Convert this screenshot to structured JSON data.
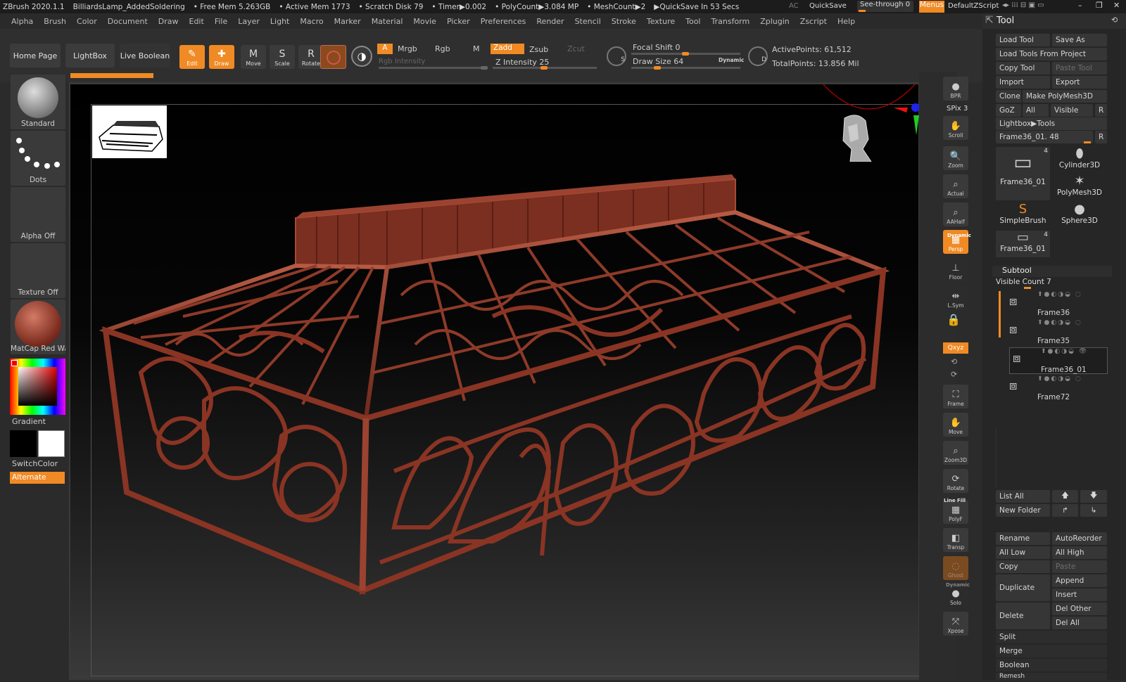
{
  "titlebar": {
    "app": "ZBrush 2020.1.1",
    "document": "BilliardsLamp_AddedSoldering",
    "free_mem": "• Free Mem 5.263GB",
    "active_mem": "• Active Mem 1773",
    "scratch": "• Scratch Disk 79",
    "timer": "• Timer▶0.002",
    "polycount": "• PolyCount▶3.084 MP",
    "meshcount": "• MeshCount▶2",
    "quicksave_in": "▶QuickSave In 53 Secs",
    "ac": "AC",
    "quicksave": "QuickSave",
    "seethrough": "See-through",
    "seethrough_val": "0",
    "menus": "Menus",
    "script": "DefaultZScript"
  },
  "menubar": [
    "Alpha",
    "Brush",
    "Color",
    "Document",
    "Draw",
    "Edit",
    "File",
    "Layer",
    "Light",
    "Macro",
    "Marker",
    "Material",
    "Movie",
    "Picker",
    "Preferences",
    "Render",
    "Stencil",
    "Stroke",
    "Texture",
    "Tool",
    "Transform",
    "Zplugin",
    "Zscript",
    "Help"
  ],
  "shelf": {
    "home": "Home Page",
    "lightbox": "LightBox",
    "liveboolean": "Live Boolean",
    "tools": [
      {
        "label": "Edit",
        "icon": "✎",
        "active": true
      },
      {
        "label": "Draw",
        "icon": "✚",
        "active": true
      },
      {
        "label": "Move",
        "icon": "M",
        "active": false
      },
      {
        "label": "Scale",
        "icon": "S",
        "active": false
      },
      {
        "label": "Rotate",
        "icon": "R",
        "active": false
      }
    ],
    "a": "A",
    "mrgb": "Mrgb",
    "rgb": "Rgb",
    "m": "M",
    "rgb_intensity": "Rgb Intensity",
    "zadd": "Zadd",
    "zsub": "Zsub",
    "zcut": "Zcut",
    "z_intensity": "Z Intensity 25",
    "focal_shift": "Focal Shift 0",
    "draw_size": "Draw Size 64",
    "dynamic": "Dynamic",
    "active_points": "ActivePoints: 61,512",
    "total_points": "TotalPoints: 13.856 Mil"
  },
  "leftshelf": {
    "brush": "Standard",
    "stroke": "Dots",
    "alpha": "Alpha Off",
    "texture": "Texture Off",
    "material": "MatCap Red Wax",
    "gradient": "Gradient",
    "switchcolor": "SwitchColor",
    "alternate": "Alternate"
  },
  "rightshelf": [
    {
      "label": "BPR",
      "icon": "●"
    },
    {
      "label": "Scroll",
      "icon": "✋"
    },
    {
      "label": "Zoom",
      "icon": "🔍"
    },
    {
      "label": "Actual",
      "icon": "⌕"
    },
    {
      "label": "AAHalf",
      "icon": "⌕"
    },
    {
      "label": "Persp",
      "icon": "▦"
    },
    {
      "label": "Floor",
      "icon": "⊥"
    },
    {
      "label": "L.Sym",
      "icon": "⇹"
    },
    {
      "label": "Frame",
      "icon": "⛶"
    },
    {
      "label": "Move",
      "icon": "✋"
    },
    {
      "label": "Zoom3D",
      "icon": "⌕"
    },
    {
      "label": "Rotate",
      "icon": "⟳"
    },
    {
      "label": "PolyF",
      "icon": "▦"
    },
    {
      "label": "Transp",
      "icon": "◧"
    },
    {
      "label": "Ghost",
      "icon": "◌"
    },
    {
      "label": "Solo",
      "icon": "●"
    },
    {
      "label": "Xpose",
      "icon": "⤧"
    }
  ],
  "rightshelf_extra": {
    "spix": "SPix 3",
    "dynamic": "Dynamic",
    "linefill": "Line Fill",
    "xyz": "Qxyz",
    "soloDynamic": "Dynamic"
  },
  "tool_panel": {
    "title": "Tool",
    "load_tool": "Load Tool",
    "save_as": "Save As",
    "load_from_project": "Load Tools From Project",
    "copy_tool": "Copy Tool",
    "paste_tool": "Paste Tool",
    "import": "Import",
    "export": "Export",
    "clone": "Clone",
    "make_polymesh": "Make PolyMesh3D",
    "goz": "GoZ",
    "all": "All",
    "visible": "Visible",
    "r": "R",
    "lightbox_tools": "Lightbox▶Tools",
    "current_tool": "Frame36_01. 48",
    "thumbs": [
      {
        "label": "Frame36_01",
        "badge": "4"
      },
      {
        "label": "Cylinder3D",
        "badge": ""
      },
      {
        "label": "PolyMesh3D",
        "badge": ""
      },
      {
        "label": "SimpleBrush",
        "badge": ""
      },
      {
        "label": "Sphere3D",
        "badge": ""
      },
      {
        "label": "Frame36_01",
        "badge": "4"
      }
    ]
  },
  "subtool": {
    "title": "Subtool",
    "visible_count": "Visible Count 7",
    "items": [
      "Frame36",
      "Frame35",
      "Frame36_01",
      "Frame72"
    ],
    "list_all": "List All",
    "new_folder": "New Folder",
    "rename": "Rename",
    "autoreorder": "AutoReorder",
    "all_low": "All Low",
    "all_high": "All High",
    "copy": "Copy",
    "paste": "Paste",
    "duplicate": "Duplicate",
    "append": "Append",
    "insert": "Insert",
    "delete": "Delete",
    "del_other": "Del Other",
    "del_all": "Del All",
    "split": "Split",
    "merge": "Merge",
    "boolean": "Boolean",
    "remesh": "Remesh"
  },
  "colors": {
    "accent": "#f08a24",
    "model": "#8a3424",
    "bg": "#2b2b2b"
  }
}
